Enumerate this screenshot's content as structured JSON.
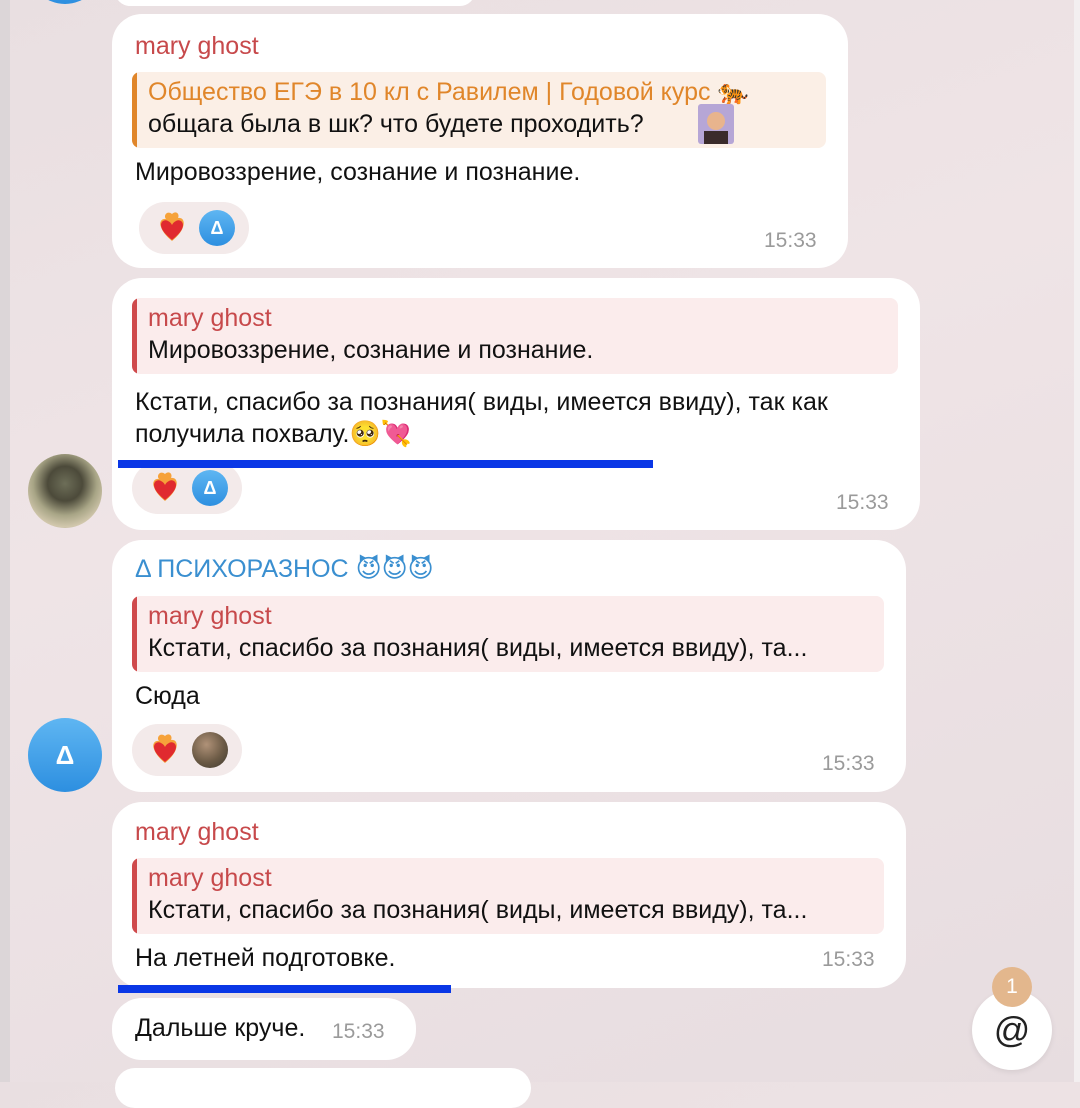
{
  "messages": [
    {
      "sender": "mary ghost",
      "quote_title": "Общество ЕГЭ в 10 кл с Равилем | Годовой курс",
      "quote_title_emoji": "🐅",
      "quote_text": "общага была в шк? что будете проходить?",
      "text": "Мировоззрение, сознание и познание.",
      "time": "15:33",
      "reaction_initial": "Δ"
    },
    {
      "quote_title": "mary ghost",
      "quote_text": "Мировоззрение, сознание и познание.",
      "text_line1": "Кстати, спасибо за познания( виды, имеется ввиду), так как",
      "text_line2": "получила похвалу.",
      "text_emojis": "🥺💘",
      "time": "15:33",
      "reaction_initial": "Δ"
    },
    {
      "sender": "Δ ПСИХОРАЗНОС",
      "sender_emojis": "😈😈😈",
      "quote_title": "mary ghost",
      "quote_text": "Кстати, спасибо за познания( виды, имеется ввиду), та...",
      "text": "Сюда",
      "time": "15:33",
      "avatar_initial": "Δ"
    },
    {
      "sender": "mary ghost",
      "quote_title": "mary ghost",
      "quote_text": "Кстати, спасибо за познания( виды, имеется ввиду), та...",
      "text": "На летней подготовке.",
      "time": "15:33"
    },
    {
      "text": "Дальше круче.",
      "time": "15:33"
    }
  ],
  "mention": {
    "count": "1",
    "icon": "@"
  },
  "colors": {
    "sender_red": "#c7494b",
    "sender_blue": "#3a8fd0",
    "quote_orange": "#e0862a",
    "underline_blue": "#0a37e6",
    "badge": "#e3b78d"
  }
}
